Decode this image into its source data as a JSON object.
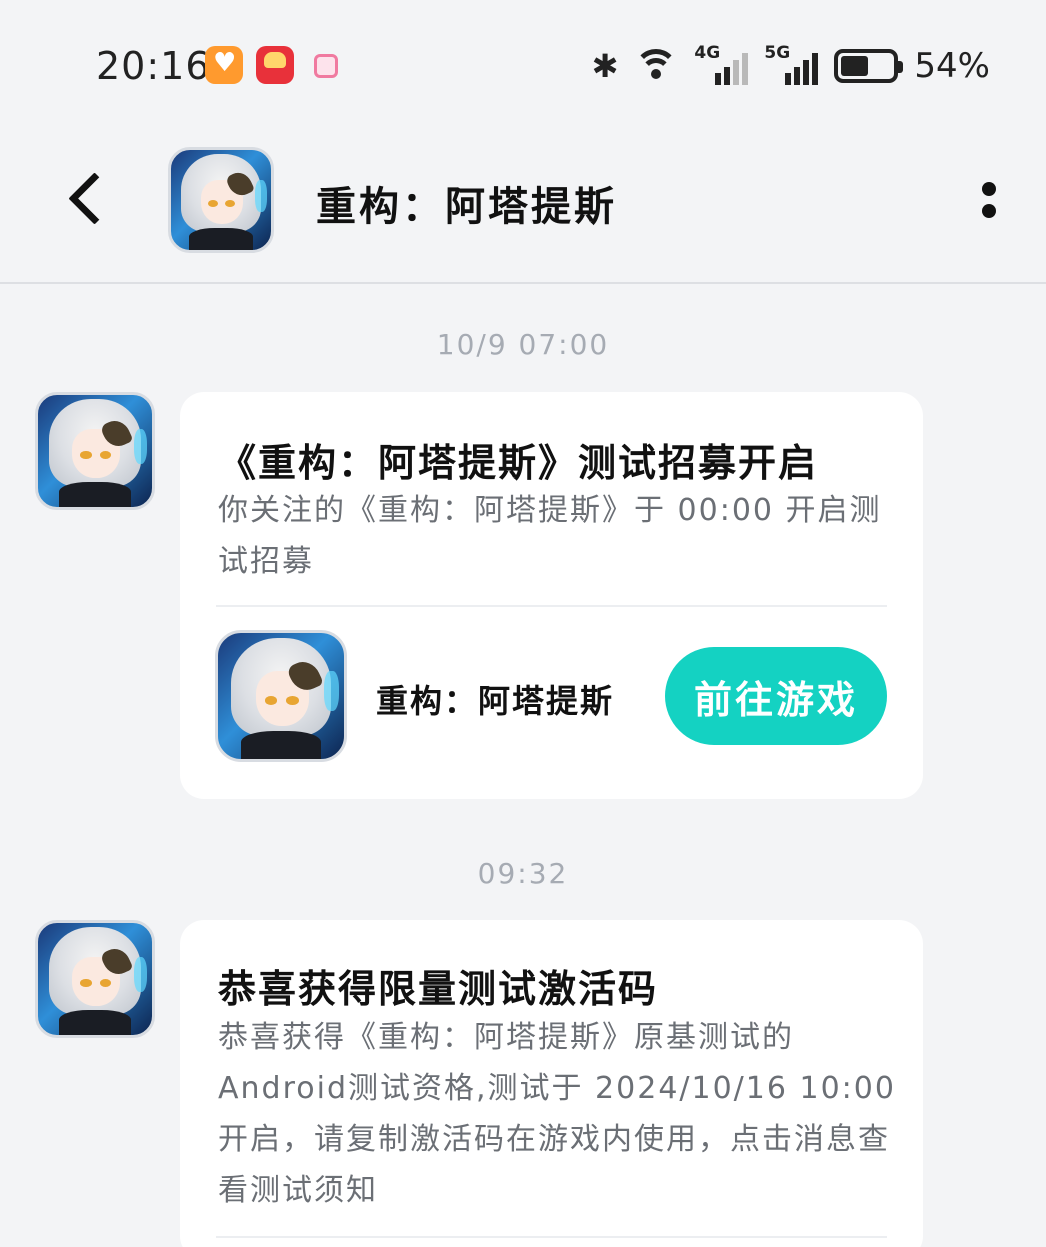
{
  "status_bar": {
    "time": "20:16",
    "network_1": "4G",
    "network_2": "5G",
    "battery_level": 0.54,
    "battery_text": "54%",
    "icons": [
      "orange-heart-app-icon",
      "red-envelope-app-icon",
      "pink-tv-app-icon",
      "bluetooth-icon",
      "wifi-icon",
      "signal-icon",
      "battery-icon"
    ]
  },
  "header": {
    "title": "重构：阿塔提斯",
    "back_icon": "chevron-left-icon",
    "more_icon": "more-vertical-icon"
  },
  "messages": [
    {
      "timestamp": "10/9  07:00",
      "title": "《重构：阿塔提斯》测试招募开启",
      "body": "你关注的《重构：阿塔提斯》于 00:00 开启测试招募",
      "game_name": "重构：阿塔提斯",
      "action_label": "前往游戏"
    },
    {
      "timestamp": "09:32",
      "title": "恭喜获得限量测试激活码",
      "body": "恭喜获得《重构：阿塔提斯》原基测试的Android测试资格,测试于 2024/10/16 10:00 开启，请复制激活码在游戏内使用，点击消息查看测试须知"
    }
  ],
  "colors": {
    "background": "#f3f4f6",
    "card": "#ffffff",
    "accent": "#14d2c2",
    "timestamp": "#a6abb3",
    "body_text": "#6b6f75"
  }
}
